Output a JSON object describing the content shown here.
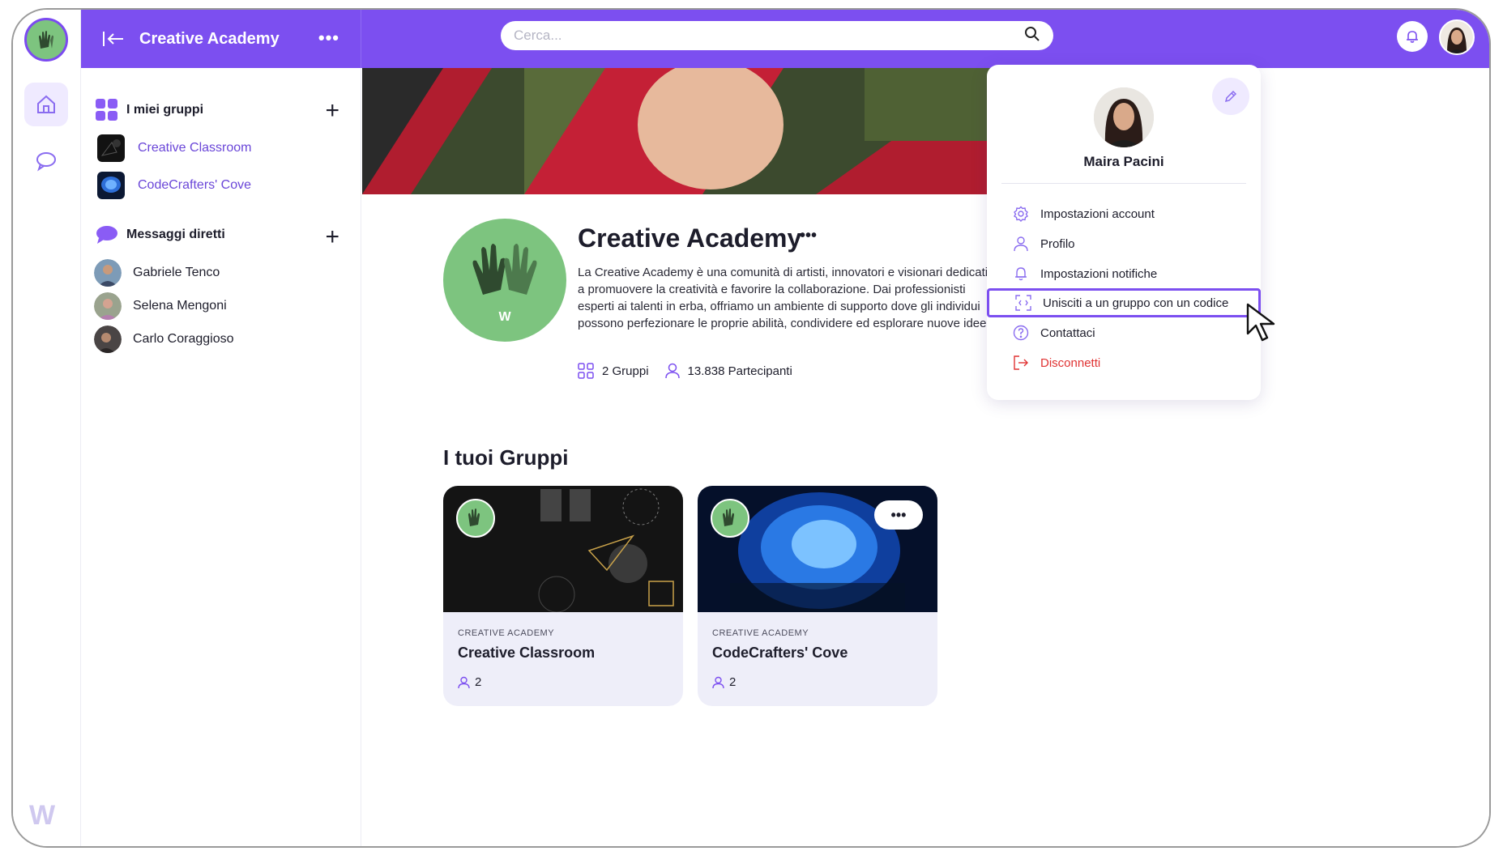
{
  "app": {
    "title": "Creative Academy",
    "accent": "#7c4ff0",
    "logo_letter": "W"
  },
  "search": {
    "placeholder": "Cerca..."
  },
  "sidebar": {
    "groups_header": "I miei gruppi",
    "groups": [
      {
        "label": "Creative Classroom"
      },
      {
        "label": "CodeCrafters' Cove"
      }
    ],
    "dm_header": "Messaggi diretti",
    "dms": [
      {
        "label": "Gabriele Tenco"
      },
      {
        "label": "Selena Mengoni"
      },
      {
        "label": "Carlo Coraggioso"
      }
    ]
  },
  "community": {
    "title": "Creative Academy",
    "description": "La Creative Academy è una comunità di artisti, innovatori e visionari dedicati a promuovere la creatività e favorire la collaborazione. Dai professionisti esperti ai talenti in erba, offriamo un ambiente di supporto dove gli individui possono perfezionare le proprie abilità, condividere ed esplorare nuove idee.",
    "groups_count": "2 Gruppi",
    "participants_count": "13.838 Partecipanti",
    "logo_letter": "W"
  },
  "your_groups": {
    "title": "I tuoi Gruppi",
    "cards": [
      {
        "org": "CREATIVE ACADEMY",
        "name": "Creative Classroom",
        "members": "2"
      },
      {
        "org": "CREATIVE ACADEMY",
        "name": "CodeCrafters' Cove",
        "members": "2"
      }
    ]
  },
  "profile_menu": {
    "user_name": "Maira Pacini",
    "items": [
      {
        "label": "Impostazioni account",
        "icon": "gear-icon"
      },
      {
        "label": "Profilo",
        "icon": "user-icon"
      },
      {
        "label": "Impostazioni notifiche",
        "icon": "bell-icon"
      },
      {
        "label": "Unisciti a un gruppo con un codice",
        "icon": "scan-icon"
      },
      {
        "label": "Contattaci",
        "icon": "help-icon"
      },
      {
        "label": "Disconnetti",
        "icon": "logout-icon"
      }
    ]
  }
}
